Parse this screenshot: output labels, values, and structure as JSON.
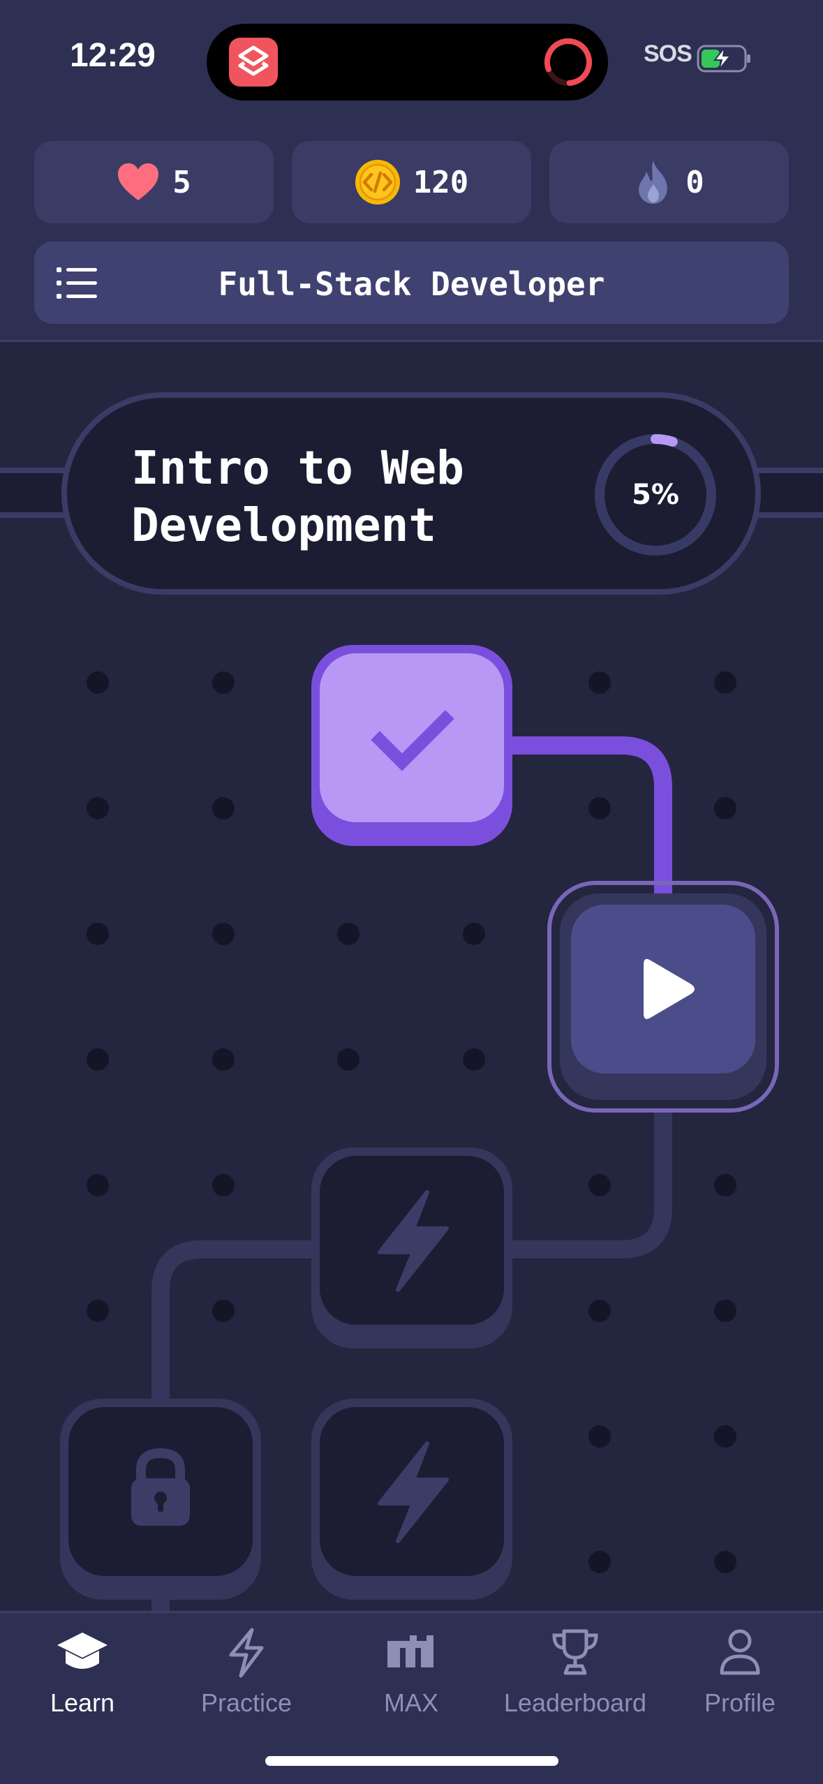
{
  "status_bar": {
    "time": "12:29",
    "sos": "SOS",
    "island_app_icon": "shortcuts-icon",
    "island_indicator_icon": "activity-ring-icon",
    "battery_icon": "battery-charging-icon"
  },
  "stats": {
    "hearts": "5",
    "coins": "120",
    "streak": "0"
  },
  "course": {
    "menu_icon": "list-icon",
    "title": "Full-Stack Developer"
  },
  "unit": {
    "title": "Intro to Web\nDevelopment",
    "progress_label": "5%",
    "progress_percent": 5
  },
  "path_nodes": [
    {
      "state": "completed",
      "icon": "checkmark-icon"
    },
    {
      "state": "current",
      "icon": "play-icon"
    },
    {
      "state": "locked-practice",
      "icon": "lightning-icon"
    },
    {
      "state": "locked",
      "icon": "lock-icon"
    },
    {
      "state": "locked-practice",
      "icon": "lightning-icon"
    }
  ],
  "nav": {
    "items": [
      {
        "label": "Learn",
        "icon": "graduation-cap-icon",
        "active": true
      },
      {
        "label": "Practice",
        "icon": "lightning-icon",
        "active": false
      },
      {
        "label": "MAX",
        "icon": "max-logo-icon",
        "active": false
      },
      {
        "label": "Leaderboard",
        "icon": "trophy-icon",
        "active": false
      },
      {
        "label": "Profile",
        "icon": "person-icon",
        "active": false
      }
    ]
  },
  "colors": {
    "background": "#24253f",
    "header": "#2d2f53",
    "accent_purple": "#7b4fdd",
    "completed_node": "#b799f5",
    "current_node": "#4b4d8a",
    "locked_node": "#1c1d33",
    "heart": "#ff6e7e",
    "coin": "#f9b806",
    "progress_arc": "#b799f5"
  }
}
